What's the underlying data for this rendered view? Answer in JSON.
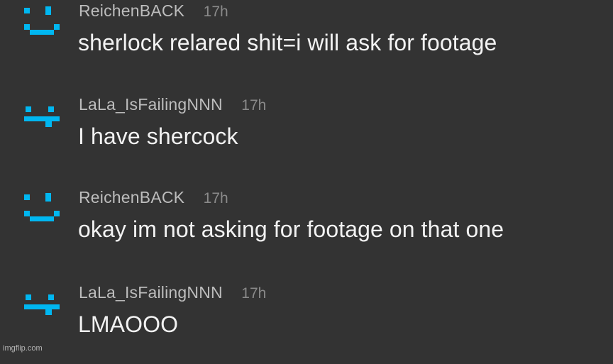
{
  "colors": {
    "background": "#333333",
    "avatar": "#00b7f1",
    "username": "#bdbdbd",
    "timestamp": "#8a8a8a",
    "message": "#f2f2f2"
  },
  "comments": [
    {
      "avatar": "smile-face-icon",
      "username": "ReichenBACK",
      "time": "17h",
      "text": "sherlock relared shit=i will ask for footage"
    },
    {
      "avatar": "flat-face-icon",
      "username": "LaLa_IsFailingNNN",
      "time": "17h",
      "text": "I have shercock"
    },
    {
      "avatar": "smile-face-icon",
      "username": "ReichenBACK",
      "time": "17h",
      "text": "okay im not asking for footage on that one"
    },
    {
      "avatar": "flat-face-icon",
      "username": "LaLa_IsFailingNNN",
      "time": "17h",
      "text": "LMAOOO"
    }
  ],
  "watermark": "imgflip.com"
}
